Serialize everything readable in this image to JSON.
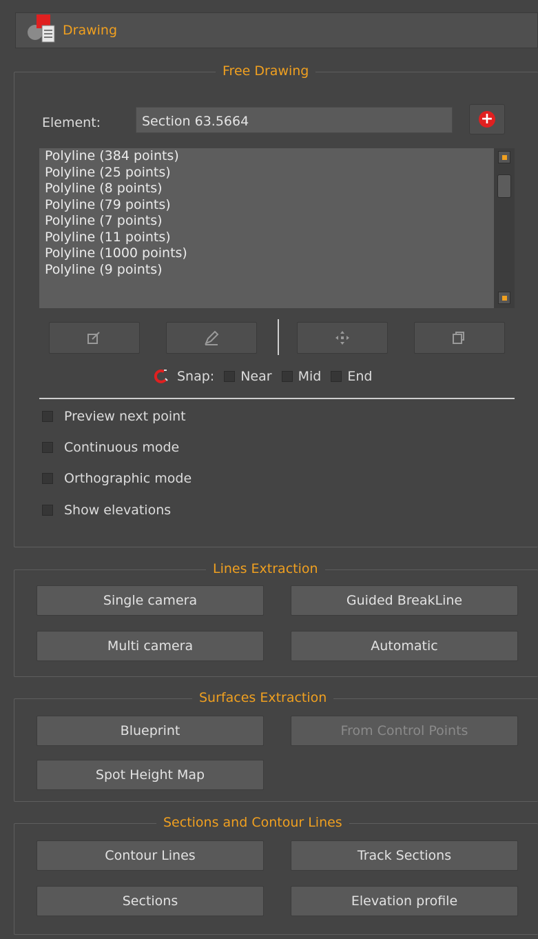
{
  "header": {
    "title": "Drawing",
    "icon": "drawing-panel-icon"
  },
  "free_drawing": {
    "title": "Free Drawing",
    "element_label": "Element:",
    "element_value": "Section 63.5664",
    "items": [
      "Polyline (384 points)",
      "Polyline (25 points)",
      "Polyline (8 points)",
      "Polyline (79 points)",
      "Polyline (7 points)",
      "Polyline (11 points)",
      "Polyline (1000 points)",
      "Polyline (9 points)"
    ],
    "tools": [
      "edit-icon",
      "pencil-icon",
      "move-icon",
      "duplicate-icon"
    ],
    "snap": {
      "label": "Snap:",
      "near": "Near",
      "mid": "Mid",
      "end": "End"
    },
    "options": {
      "preview": "Preview next point",
      "continuous": "Continuous mode",
      "orthographic": "Orthographic mode",
      "elevations": "Show elevations"
    }
  },
  "lines_extraction": {
    "title": "Lines Extraction",
    "single_camera": "Single camera",
    "guided_breakline": "Guided BreakLine",
    "multi_camera": "Multi camera",
    "automatic": "Automatic"
  },
  "surfaces_extraction": {
    "title": "Surfaces Extraction",
    "blueprint": "Blueprint",
    "from_control_points": "From Control Points",
    "spot_height_map": "Spot Height Map"
  },
  "sections_contours": {
    "title": "Sections and Contour Lines",
    "contour_lines": "Contour Lines",
    "track_sections": "Track Sections",
    "sections": "Sections",
    "elevation_profile": "Elevation profile"
  },
  "colors": {
    "accent": "#f0a020",
    "add": "#e02020",
    "background": "#444444"
  }
}
